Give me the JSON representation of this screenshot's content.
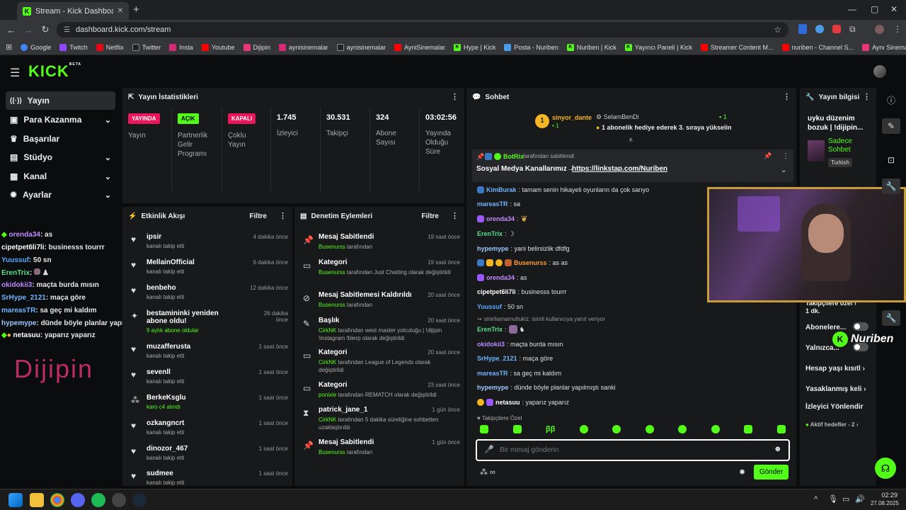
{
  "browser": {
    "tab_title": "Stream - Kick Dashboard",
    "url": "dashboard.kick.com/stream",
    "bookmarks": [
      "Google",
      "Twitch",
      "Netflix",
      "Twitter",
      "Insta",
      "Youtube",
      "Dijipin",
      "aynisinemalar",
      "aynisinemalar",
      "AyniSinemalar",
      "Hype | Kick",
      "Posta - Nuriben",
      "Nuriben | Kick",
      "Yayıncı Paneli | Kick",
      "Streamer Content M...",
      "nuriben - Channel S...",
      "Aynı Sinemalar - Ça..."
    ]
  },
  "brand": {
    "logo": "KICK",
    "beta": "BETA",
    "accent": "#53fc18"
  },
  "sidebar": {
    "items": [
      {
        "label": "Yayın",
        "icon": "broadcast-icon"
      },
      {
        "label": "Para Kazanma",
        "icon": "money-icon"
      },
      {
        "label": "Başarılar",
        "icon": "trophy-icon"
      },
      {
        "label": "Stüdyo",
        "icon": "studio-icon"
      },
      {
        "label": "Kanal",
        "icon": "channel-icon"
      },
      {
        "label": "Ayarlar",
        "icon": "gear-icon"
      }
    ]
  },
  "overlay_chat": [
    {
      "user": "orenda34",
      "text": ": as",
      "color": "#c48bff"
    },
    {
      "user": "cipetpet6li7li",
      "text": ": businesss tourrr",
      "color": "#ffffff"
    },
    {
      "user": "Yuussuf",
      "text": ": 50 sn",
      "color": "#5aa9ff"
    },
    {
      "user": "ErenTrix",
      "text": ": ",
      "color": "#58e08c"
    },
    {
      "user": "okidokii3",
      "text": ": maçta burda mısın",
      "color": "#b889ff"
    },
    {
      "user": "SrHype_2121",
      "text": ": maça göre",
      "color": "#6fb4ff"
    },
    {
      "user": "mareasTR",
      "text": ": sa geç mi kaldım",
      "color": "#6fb4ff"
    },
    {
      "user": "hypemype",
      "text": ": dünde böyle planlar yapılmıştı sanki",
      "color": "#9ec7ff"
    },
    {
      "user": "netasuu",
      "text": ": yaparız yaparız",
      "color": "#ffffff"
    }
  ],
  "overlay_logo": "Dijipin",
  "stats": {
    "title": "Yayın İstatistikleri",
    "cells": [
      {
        "badge": "YAYINDA",
        "badge_color": "#e9165b",
        "label": "Yayın"
      },
      {
        "badge": "AÇIK",
        "badge_color": "#53fc18",
        "label": "Partnerlik Gelir Programı"
      },
      {
        "badge": "KAPALI",
        "badge_color": "#e9165b",
        "label": "Çoklu Yayın"
      },
      {
        "value": "1.745",
        "label": "İzleyici"
      },
      {
        "value": "30.531",
        "label": "Takipçi"
      },
      {
        "value": "324",
        "label": "Abone Sayısı"
      },
      {
        "value": "03:02:56",
        "label": "Yayında Olduğu Süre"
      }
    ]
  },
  "activity": {
    "title": "Etkinlik Akışı",
    "filter": "Filtre",
    "items": [
      {
        "name": "ipsir",
        "sub": "kanalı takip etti",
        "time": "4 dakika önce",
        "icon": "heart-icon"
      },
      {
        "name": "MellainOfficial",
        "sub": "kanalı takip etti",
        "time": "6 dakika önce",
        "icon": "heart-icon"
      },
      {
        "name": "benbeho",
        "sub": "kanalı takip etti",
        "time": "12 dakika önce",
        "icon": "heart-icon"
      },
      {
        "name": "bestamininki yeniden abone oldu!",
        "sub": "9 aylık abone oldular",
        "time": "26 dakika önce",
        "icon": "star-icon",
        "sub_green": true
      },
      {
        "name": "muzafferusta",
        "sub": "kanalı takip etti",
        "time": "1 saat önce",
        "icon": "heart-icon"
      },
      {
        "name": "sevenll",
        "sub": "kanalı takip etti",
        "time": "1 saat önce",
        "icon": "heart-icon"
      },
      {
        "name": "BerkeKsglu",
        "sub": "karo c4 alındı",
        "time": "1 saat önce",
        "icon": "gift-icon",
        "sub_green": true
      },
      {
        "name": "ozkangncrt",
        "sub": "kanalı takip etti",
        "time": "1 saat önce",
        "icon": "heart-icon"
      },
      {
        "name": "dinozor_467",
        "sub": "kanalı takip etti",
        "time": "1 saat önce",
        "icon": "heart-icon"
      },
      {
        "name": "sudmee",
        "sub": "kanalı takip etti",
        "time": "1 saat önce",
        "icon": "heart-icon"
      }
    ]
  },
  "moderation": {
    "title": "Denetim Eylemleri",
    "filter": "Filtre",
    "items": [
      {
        "title": "Mesaj Sabitlendi",
        "actor": "Busenurss",
        "rest": " tarafından",
        "time": "19 saat önce",
        "icon": "pin-icon"
      },
      {
        "title": "Kategori",
        "actor": "Busenurss",
        "rest": " tarafından Just Chatting olarak değiştirildi",
        "time": "19 saat önce",
        "icon": "category-icon"
      },
      {
        "title": "Mesaj Sabitlemesi Kaldırıldı",
        "actor": "Busenurss",
        "rest": " tarafından",
        "time": "20 saat önce",
        "icon": "unpin-icon"
      },
      {
        "title": "Başlık",
        "actor": "CirkNK",
        "rest": " tarafından west master yolculuğu | !dijipin !instagram !blerp olarak değiştirildi",
        "time": "20 saat önce",
        "icon": "title-icon"
      },
      {
        "title": "Kategori",
        "actor": "CirkNK",
        "rest": " tarafından League of Legends olarak değiştirildi",
        "time": "20 saat önce",
        "icon": "category-icon"
      },
      {
        "title": "Kategori",
        "actor": "ponixie",
        "rest": " tarafından REMATCH olarak değiştirildi",
        "time": "23 saat önce",
        "icon": "category-icon"
      },
      {
        "title": "patrick_jane_1",
        "actor": "CirkNK",
        "rest": " tarafından 5 dakika süreliğine sohbetten uzaklaştırıldı",
        "time": "1 gün önce",
        "icon": "timeout-icon"
      },
      {
        "title": "Mesaj Sabitlendi",
        "actor": "Busenurss",
        "rest": " tarafından",
        "time": "1 gün önce",
        "icon": "pin-icon"
      }
    ]
  },
  "chat": {
    "title": "Sohbet",
    "top_gifter": {
      "rank": "1",
      "name": "sinyor_dante",
      "count": "1"
    },
    "gift_user": "SelamBenDi",
    "gift_count": "1",
    "gift_text": "1 abonelik hediye ederek 3. sıraya yükselin",
    "pinned_by": "BotRix",
    "pinned_by_rest": "tarafından sabitlendi",
    "pinned_text": "Sosyal Medya Kanallarımız→",
    "pinned_link": "https://linkstap.com/Nuriben",
    "messages": [
      {
        "user": "KimBurak",
        "text": ": tamam senin hikayeli oyunların da çok sarıyo",
        "color": "#6fb4ff"
      },
      {
        "user": "mareasTR",
        "text": ": sa",
        "color": "#6fb4ff"
      },
      {
        "user": "orenda34",
        "text": ": ",
        "color": "#c48bff"
      },
      {
        "user": "ErenTrix",
        "text": ": ",
        "color": "#58e08c"
      },
      {
        "user": "hypemype",
        "text": ": yani belirsizlik dfdfg",
        "color": "#9ec7ff"
      },
      {
        "user": "Busenurss",
        "text": ": as as",
        "color": "#ff9c33"
      },
      {
        "user": "orenda34",
        "text": ": as",
        "color": "#c48bff"
      },
      {
        "user": "cipetpet6li7li",
        "text": ": businesss tourrr",
        "color": "#ffffff"
      },
      {
        "user": "Yuussuf",
        "text": ": 50 sn",
        "color": "#5aa9ff"
      },
      {
        "user": "ErenTrix",
        "text": ": ",
        "color": "#58e08c",
        "reply": "sinirliamamutlukiz:  isimli kullanıcıya yanıt veriyor"
      },
      {
        "user": "okidokii3",
        "text": ": maçta burda mısın",
        "color": "#b889ff"
      },
      {
        "user": "SrHype_2121",
        "text": ": maça göre",
        "color": "#6fb4ff"
      },
      {
        "user": "mareasTR",
        "text": ": sa geç mi kaldım",
        "color": "#6fb4ff"
      },
      {
        "user": "hypemype",
        "text": ": dünde böyle planlar yapılmıştı sanki",
        "color": "#9ec7ff"
      },
      {
        "user": "netasuu",
        "text": ": yaparız yaparız",
        "color": "#ffffff"
      }
    ],
    "followers_only": "Takipçilere Özel",
    "input_placeholder": "Bir mesaj gönderin",
    "send_label": "Gönder"
  },
  "stream_info": {
    "title": "Yayın bilgisi",
    "stream_title": "uyku düzenim bozuk | !dijipin...",
    "category": "Sadece Sohbet",
    "tag": "Turkish",
    "rows": [
      "Takipçilere özel",
      "1 dk.",
      "Abonelere...",
      "Yalnızca...",
      "Hesap yaşı kısıtl",
      "Yasaklanmış keli",
      "İzleyici Yönlendir",
      "Aktif hedefler - 2"
    ]
  },
  "webcam_name": "Nuriben",
  "taskbar": {
    "time": "02:29",
    "date": "27.08.2025"
  }
}
